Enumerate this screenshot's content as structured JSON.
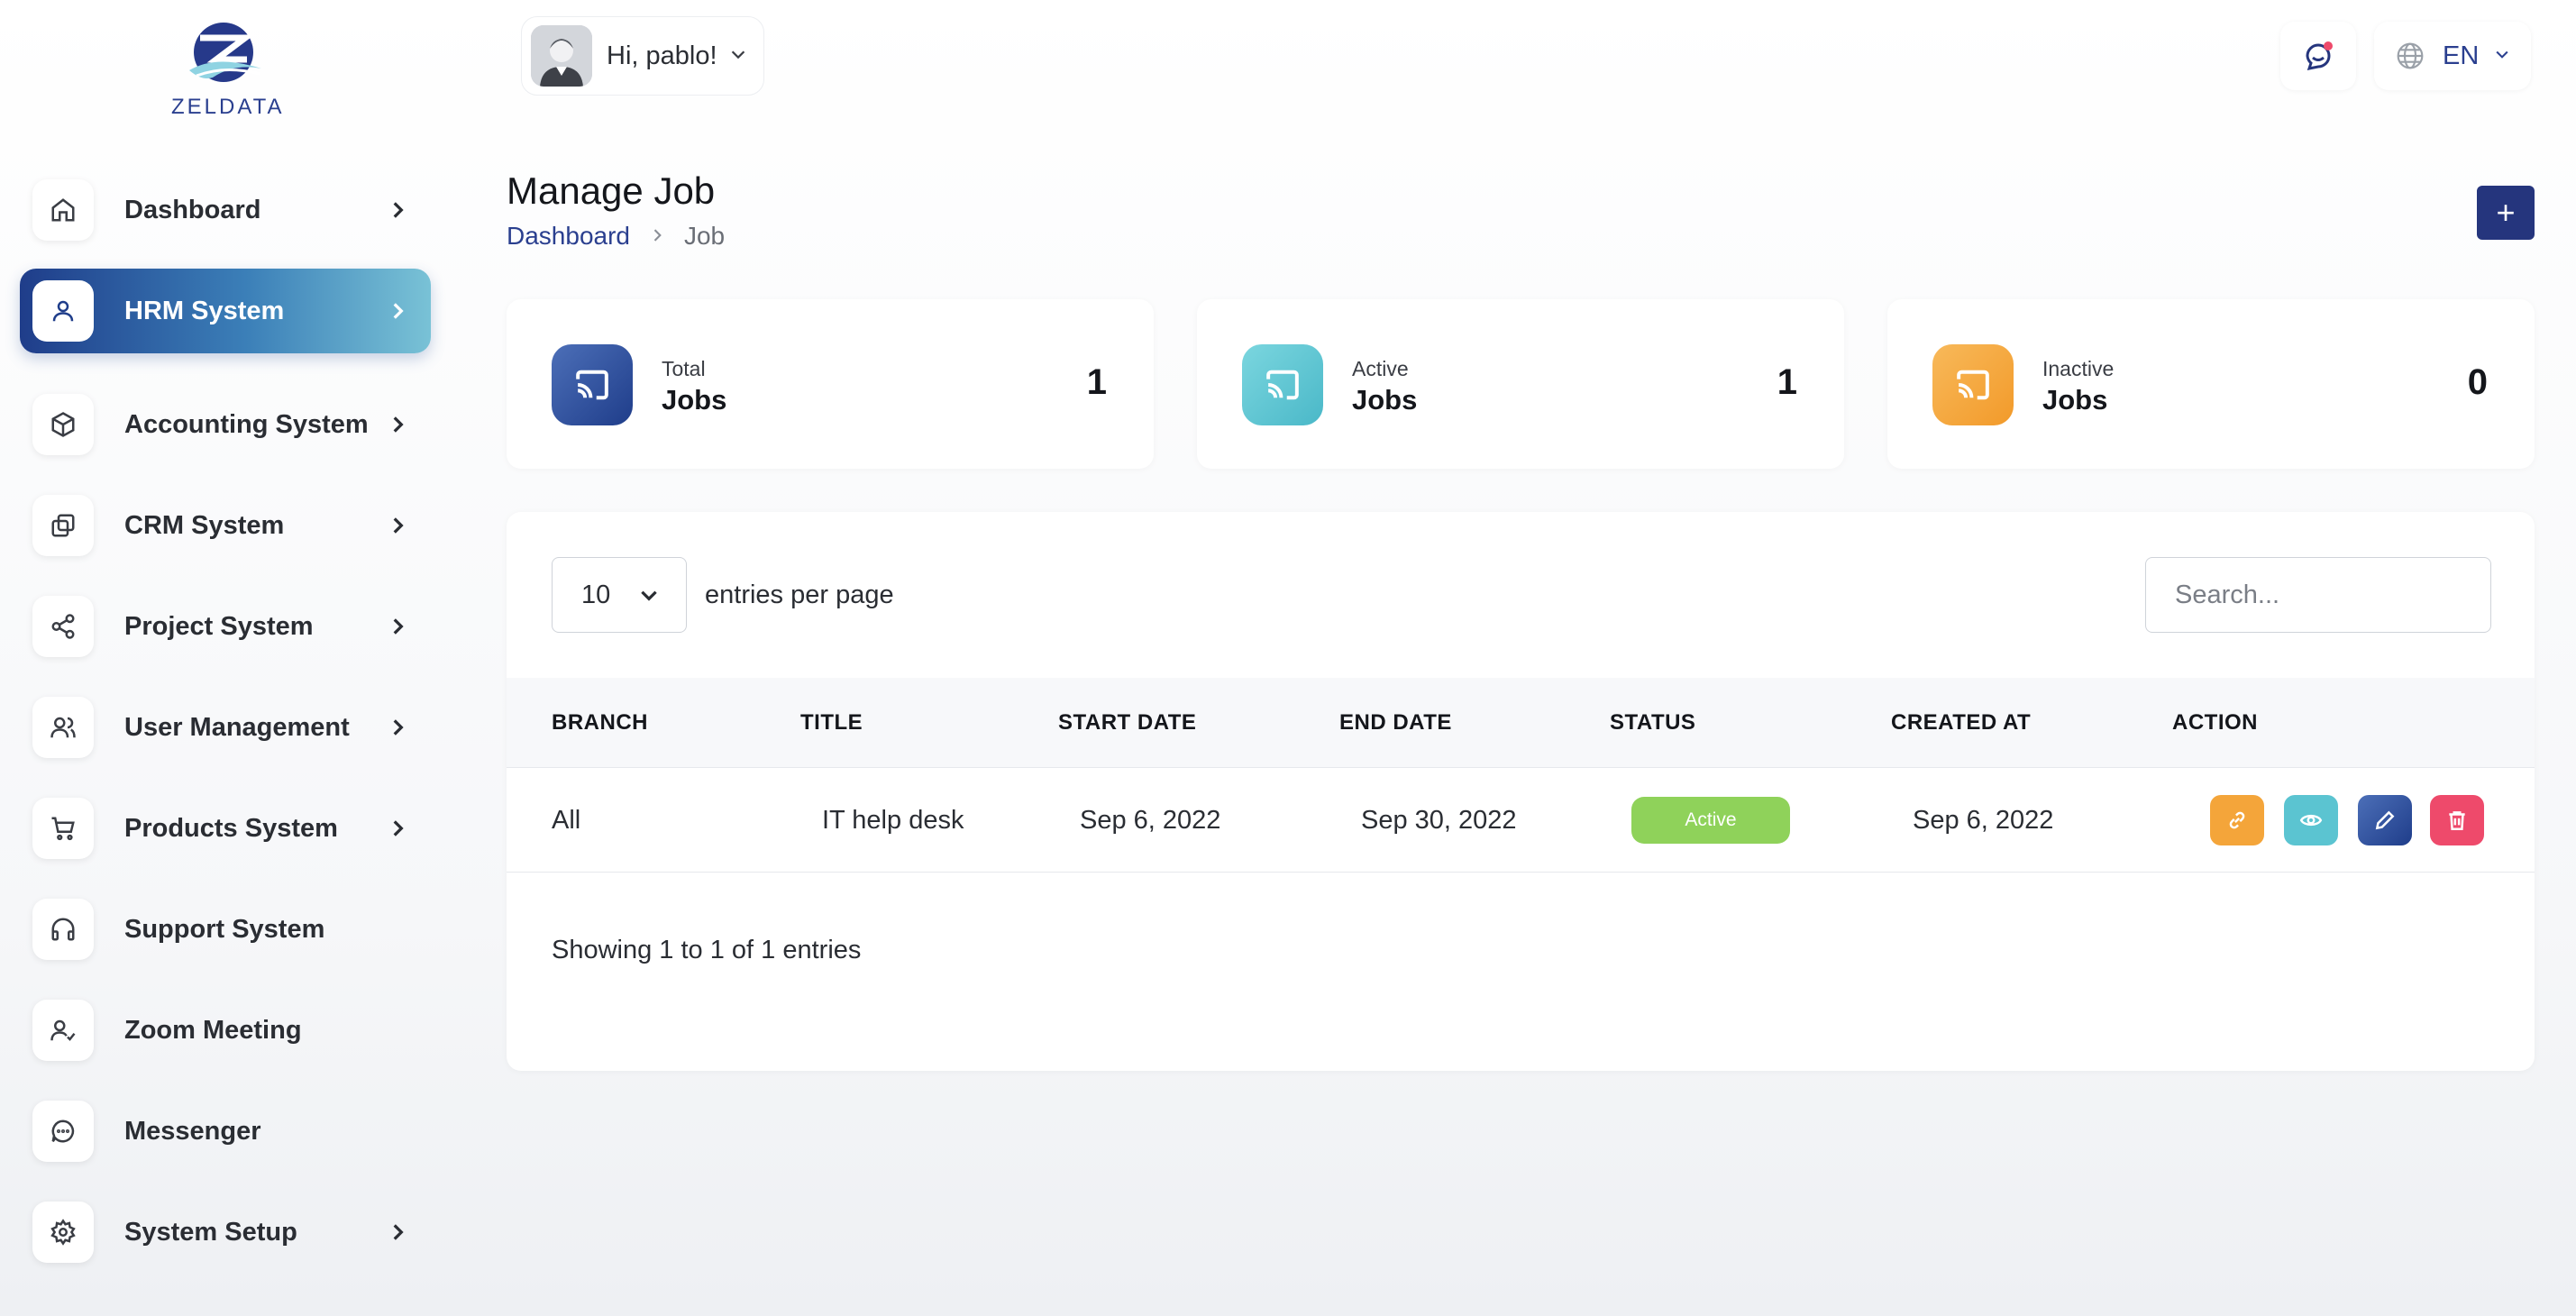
{
  "logo": {
    "text": "ZELDATA"
  },
  "sidebar": {
    "items": [
      {
        "label": "Dashboard",
        "icon": "home-icon",
        "has_children": true,
        "active": false
      },
      {
        "label": "HRM System",
        "icon": "user-icon",
        "has_children": true,
        "active": true
      },
      {
        "label": "Accounting System",
        "icon": "box-icon",
        "has_children": true,
        "active": false
      },
      {
        "label": "CRM System",
        "icon": "layers-icon",
        "has_children": true,
        "active": false
      },
      {
        "label": "Project System",
        "icon": "share-icon",
        "has_children": true,
        "active": false
      },
      {
        "label": "User Management",
        "icon": "users-icon",
        "has_children": true,
        "active": false
      },
      {
        "label": "Products System",
        "icon": "cart-icon",
        "has_children": true,
        "active": false
      },
      {
        "label": "Support System",
        "icon": "headphones-icon",
        "has_children": false,
        "active": false
      },
      {
        "label": "Zoom Meeting",
        "icon": "user-check-icon",
        "has_children": false,
        "active": false
      },
      {
        "label": "Messenger",
        "icon": "message-icon",
        "has_children": false,
        "active": false
      },
      {
        "label": "System Setup",
        "icon": "gear-icon",
        "has_children": true,
        "active": false
      }
    ]
  },
  "header": {
    "greeting": "Hi, pablo!",
    "language": "EN"
  },
  "page": {
    "title": "Manage Job",
    "breadcrumb": {
      "home": "Dashboard",
      "current": "Job"
    },
    "add_label": "+"
  },
  "stats": [
    {
      "small": "Total",
      "big": "Jobs",
      "value": "1",
      "color": "#2b4a93"
    },
    {
      "small": "Active",
      "big": "Jobs",
      "value": "1",
      "color": "#5bc4d1"
    },
    {
      "small": "Inactive",
      "big": "Jobs",
      "value": "0",
      "color": "#f4a53a"
    }
  ],
  "table": {
    "per_page": "10",
    "per_page_label": "entries per page",
    "search_placeholder": "Search...",
    "columns": [
      "BRANCH",
      "TITLE",
      "START DATE",
      "END DATE",
      "STATUS",
      "CREATED AT",
      "ACTION"
    ],
    "rows": [
      {
        "branch": "All",
        "title": "IT help desk",
        "start_date": "Sep 6, 2022",
        "end_date": "Sep 30, 2022",
        "status": "Active",
        "created_at": "Sep 6, 2022"
      }
    ],
    "footer": "Showing 1 to 1 of 1 entries"
  },
  "colors": {
    "primary": "#25357d",
    "status_active": "#8fd25a",
    "action_copy": "#f4a53a",
    "action_view": "#5bc4d1",
    "action_edit": "#2b4a93",
    "action_delete": "#ee4a6b"
  }
}
